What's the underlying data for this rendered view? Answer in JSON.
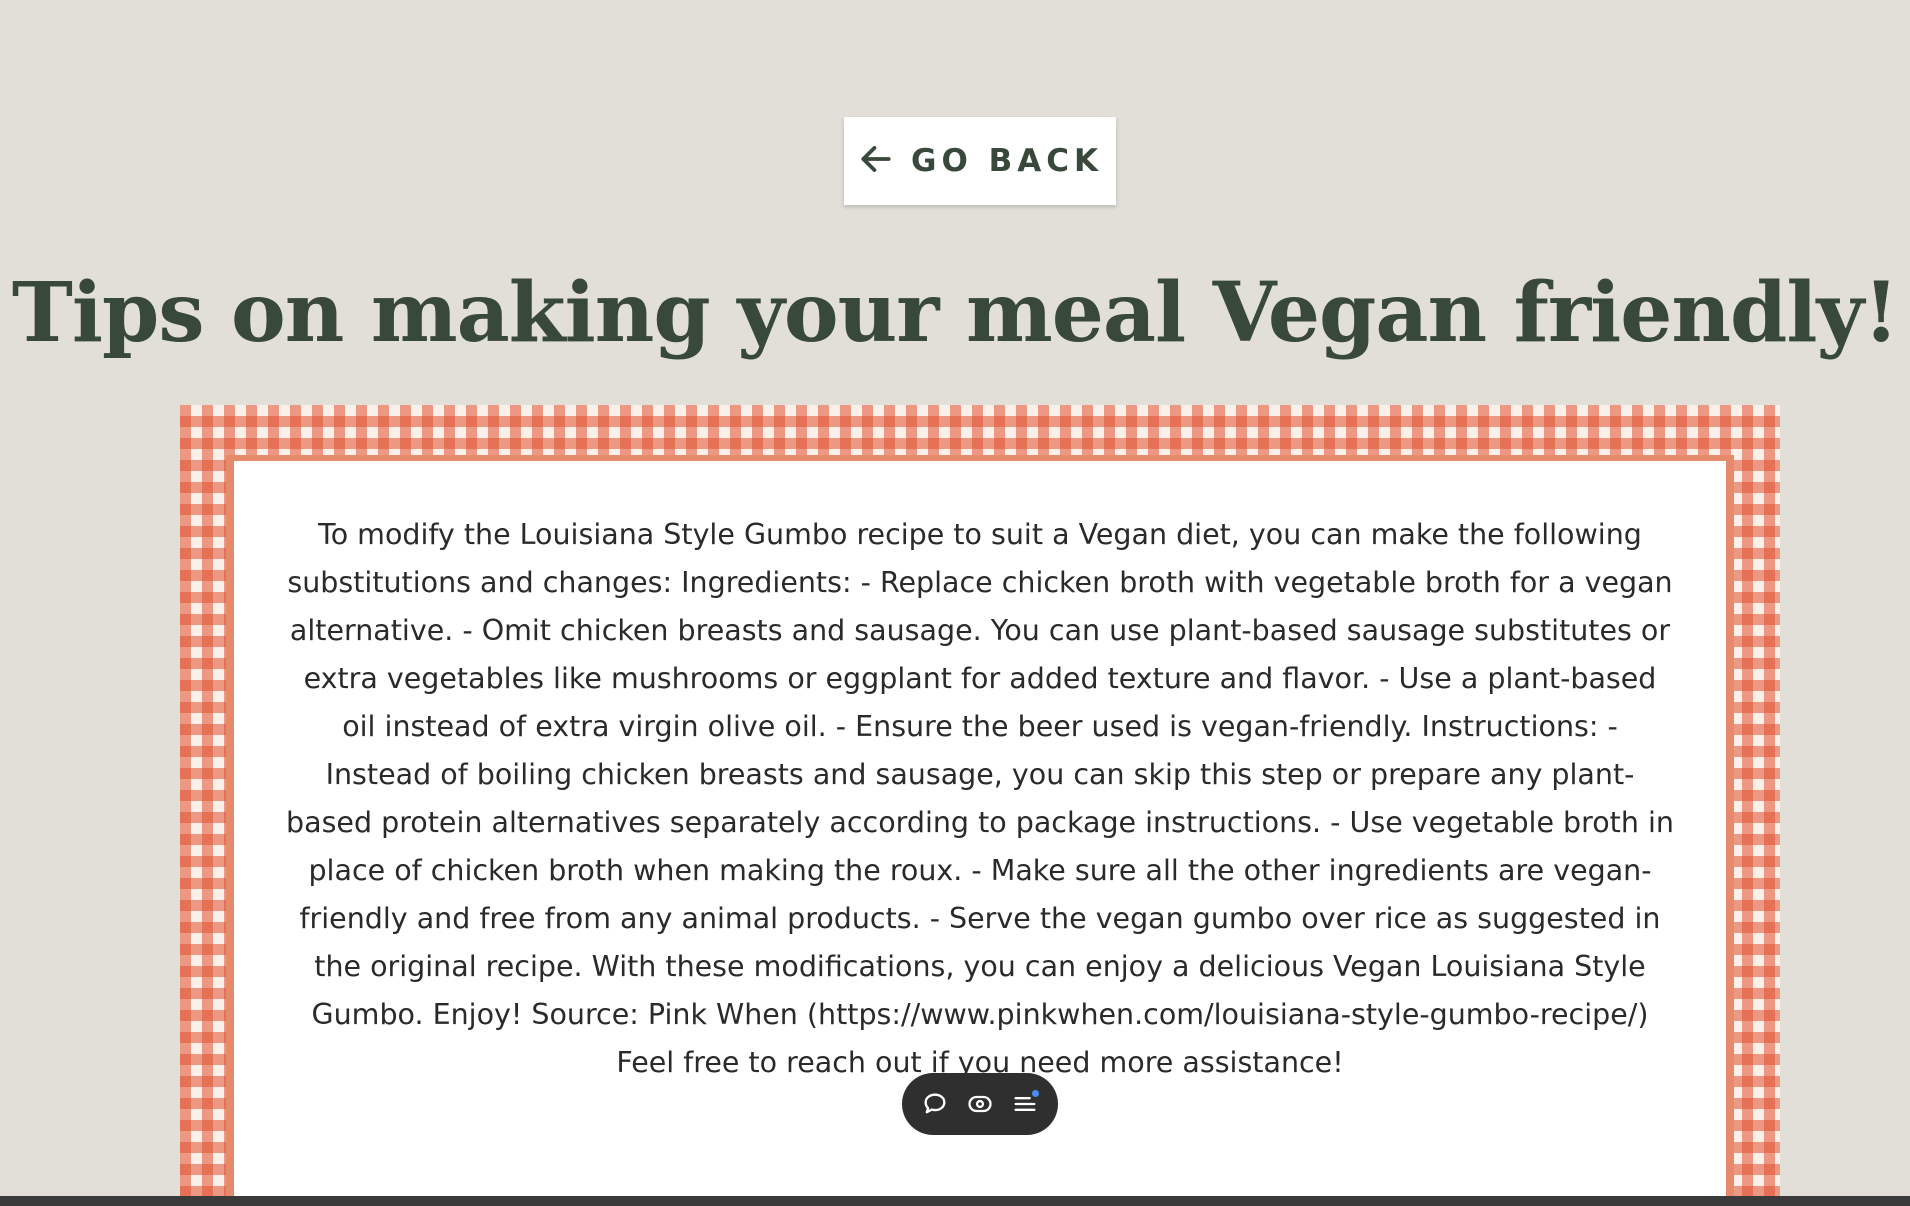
{
  "nav": {
    "back_label": "GO BACK"
  },
  "page": {
    "title": "Tips on making your meal Vegan friendly!"
  },
  "tips": {
    "body": "To modify the Louisiana Style Gumbo recipe to suit a Vegan diet, you can make the following substitutions and changes: Ingredients: - Replace chicken broth with vegetable broth for a vegan alternative. - Omit chicken breasts and sausage. You can use plant-based sausage substitutes or extra vegetables like mushrooms or eggplant for added texture and flavor. - Use a plant-based oil instead of extra virgin olive oil. - Ensure the beer used is vegan-friendly. Instructions: - Instead of boiling chicken breasts and sausage, you can skip this step or prepare any plant-based protein alternatives separately according to package instructions. - Use vegetable broth in place of chicken broth when making the roux. - Make sure all the other ingredients are vegan-friendly and free from any animal products. - Serve the vegan gumbo over rice as suggested in the original recipe. With these modifications, you can enjoy a delicious Vegan Louisiana Style Gumbo. Enjoy! Source: Pink When (https://www.pinkwhen.com/louisiana-style-gumbo-recipe/) Feel free to reach out if you need more assistance!"
  },
  "toolbar": {
    "icons": [
      "comment-icon",
      "eye-icon",
      "menu-icon"
    ]
  },
  "colors": {
    "background": "#e1dfd8",
    "heading": "#38483a",
    "gingham_red": "#e05030",
    "toolbar_bg": "#2f2f2f",
    "notification_dot": "#4b8bf5"
  }
}
